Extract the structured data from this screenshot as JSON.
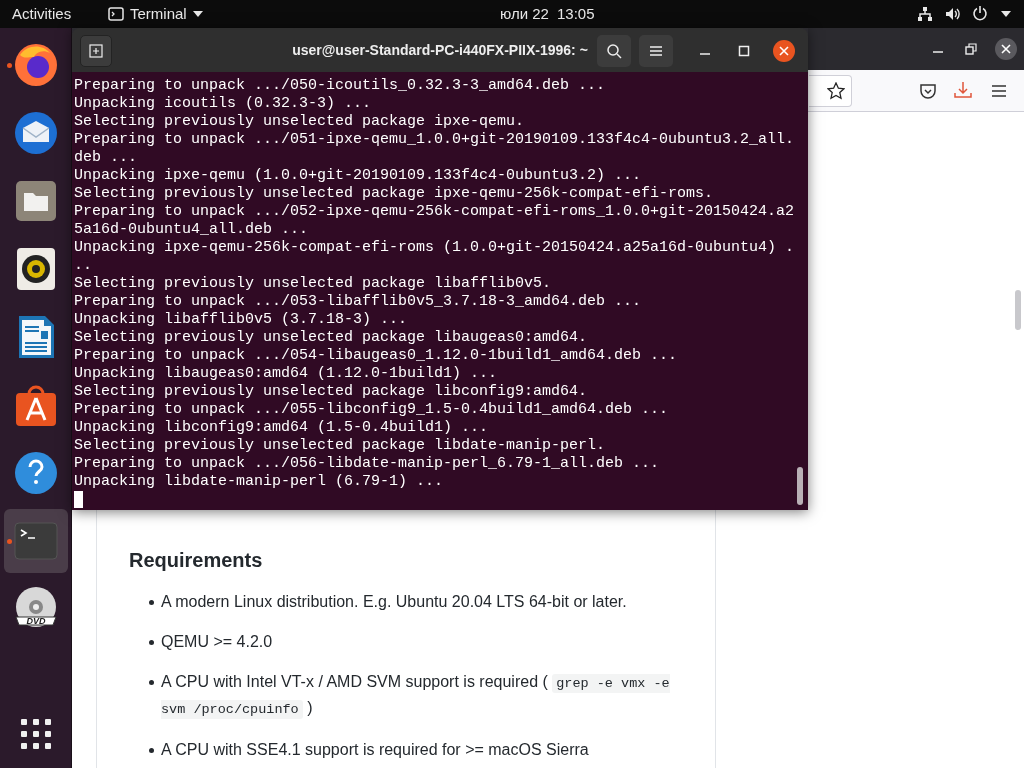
{
  "top_bar": {
    "activities": "Activities",
    "app_menu": "Terminal",
    "date": "юли 22",
    "time": "13:05"
  },
  "dock": {
    "items": [
      {
        "kind": "firefox",
        "running": true,
        "selected": false
      },
      {
        "kind": "mail",
        "running": false,
        "selected": false
      },
      {
        "kind": "files",
        "running": false,
        "selected": false
      },
      {
        "kind": "music",
        "running": false,
        "selected": false
      },
      {
        "kind": "writer",
        "running": false,
        "selected": false
      },
      {
        "kind": "store",
        "running": false,
        "selected": false
      },
      {
        "kind": "help",
        "running": false,
        "selected": false
      },
      {
        "kind": "terminal",
        "running": true,
        "selected": true
      },
      {
        "kind": "dvd",
        "running": false,
        "selected": false,
        "label": "DVD"
      }
    ]
  },
  "browser": {
    "heading": "Requirements",
    "bullets": [
      [
        {
          "text": "A modern Linux distribution. E.g. Ubuntu 20.04 LTS 64-bit or later."
        }
      ],
      [
        {
          "text": "QEMU >= 4.2.0"
        }
      ],
      [
        {
          "text": "A CPU with Intel VT-x / AMD SVM support is required ( "
        },
        {
          "code": "grep -e vmx -e svm /proc/cpuinfo"
        },
        {
          "text": " )"
        }
      ],
      [
        {
          "text": "A CPU with SSE4.1 support is required for >= macOS Sierra"
        }
      ]
    ]
  },
  "terminal": {
    "title": "user@user-Standard-PC-i440FX-PIIX-1996: ~",
    "lines": [
      "Preparing to unpack .../050-icoutils_0.32.3-3_amd64.deb ...",
      "Unpacking icoutils (0.32.3-3) ...",
      "Selecting previously unselected package ipxe-qemu.",
      "Preparing to unpack .../051-ipxe-qemu_1.0.0+git-20190109.133f4c4-0ubuntu3.2_all.",
      "deb ...",
      "Unpacking ipxe-qemu (1.0.0+git-20190109.133f4c4-0ubuntu3.2) ...",
      "Selecting previously unselected package ipxe-qemu-256k-compat-efi-roms.",
      "Preparing to unpack .../052-ipxe-qemu-256k-compat-efi-roms_1.0.0+git-20150424.a2",
      "5a16d-0ubuntu4_all.deb ...",
      "Unpacking ipxe-qemu-256k-compat-efi-roms (1.0.0+git-20150424.a25a16d-0ubuntu4) .",
      "..",
      "Selecting previously unselected package libafflib0v5.",
      "Preparing to unpack .../053-libafflib0v5_3.7.18-3_amd64.deb ...",
      "Unpacking libafflib0v5 (3.7.18-3) ...",
      "Selecting previously unselected package libaugeas0:amd64.",
      "Preparing to unpack .../054-libaugeas0_1.12.0-1build1_amd64.deb ...",
      "Unpacking libaugeas0:amd64 (1.12.0-1build1) ...",
      "Selecting previously unselected package libconfig9:amd64.",
      "Preparing to unpack .../055-libconfig9_1.5-0.4build1_amd64.deb ...",
      "Unpacking libconfig9:amd64 (1.5-0.4build1) ...",
      "Selecting previously unselected package libdate-manip-perl.",
      "Preparing to unpack .../056-libdate-manip-perl_6.79-1_all.deb ...",
      "Unpacking libdate-manip-perl (6.79-1) ..."
    ]
  }
}
